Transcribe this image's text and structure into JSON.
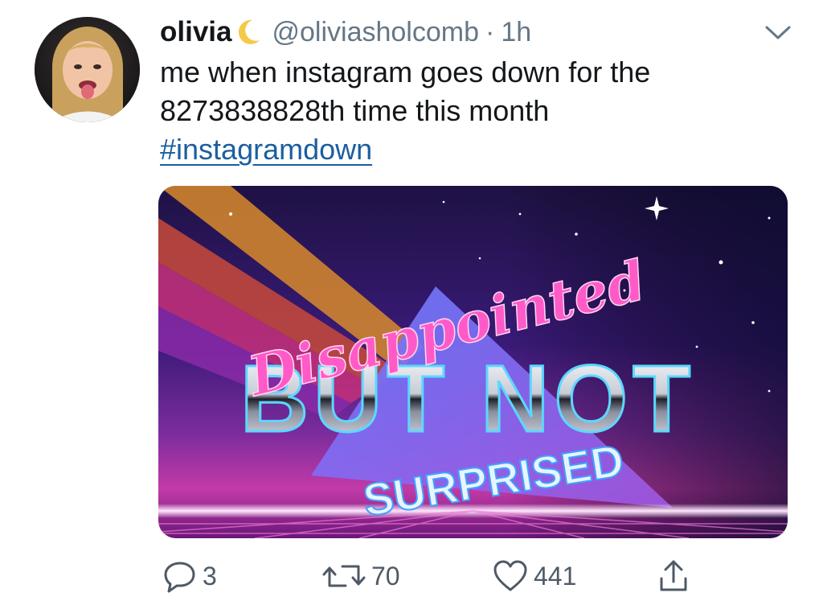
{
  "tweet": {
    "display_name": "olivia",
    "name_emoji_icon": "crescent-moon-icon",
    "handle": "@oliviasholcomb",
    "separator": "·",
    "time": "1h",
    "text_line1": "me when instagram goes down for the",
    "text_line2": "8273838828th time this month",
    "hashtag": "#instagramdown",
    "image": {
      "line1": "Disappointed",
      "line2": "BUT NOT",
      "line3": "SURPRISED"
    },
    "actions": {
      "replies": "3",
      "retweets": "70",
      "likes": "441"
    }
  },
  "colors": {
    "text": "#14171a",
    "muted": "#657786",
    "link": "#1b5e9f",
    "icon": "#4e5a66"
  }
}
